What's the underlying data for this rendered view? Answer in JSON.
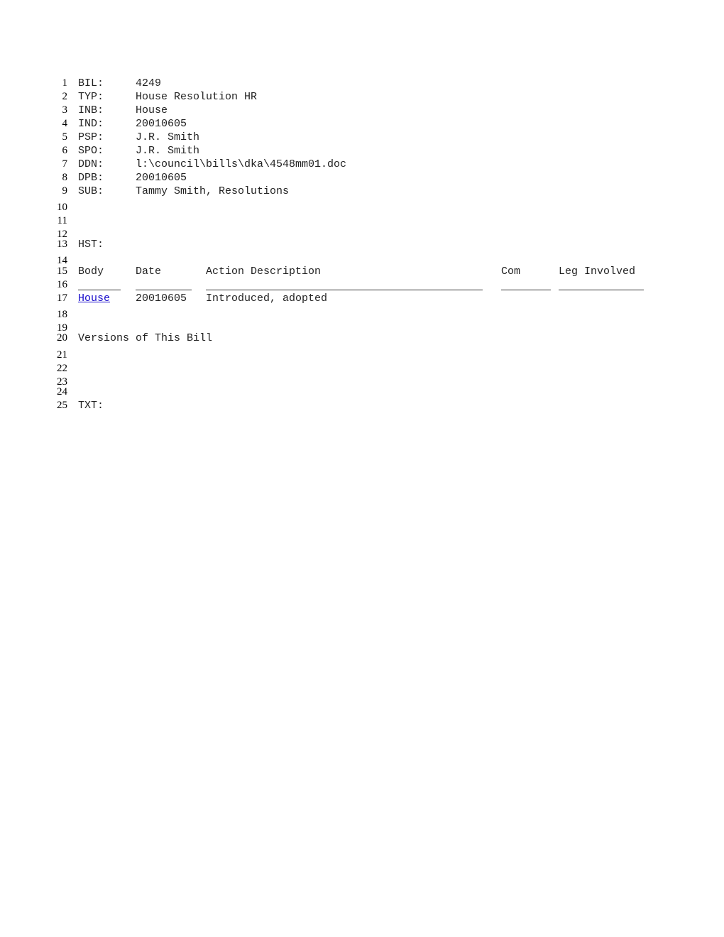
{
  "fields": [
    {
      "num": "1",
      "key": "BIL:",
      "value": "4249"
    },
    {
      "num": "2",
      "key": "TYP:",
      "value": "House Resolution HR"
    },
    {
      "num": "3",
      "key": "INB:",
      "value": "House"
    },
    {
      "num": "4",
      "key": "IND:",
      "value": "20010605"
    },
    {
      "num": "5",
      "key": "PSP:",
      "value": "J.R. Smith"
    },
    {
      "num": "6",
      "key": "SPO:",
      "value": "J.R. Smith"
    },
    {
      "num": "7",
      "key": "DDN:",
      "value": "l:\\council\\bills\\dka\\4548mm01.doc"
    },
    {
      "num": "8",
      "key": "DPB:",
      "value": "20010605"
    },
    {
      "num": "9",
      "key": "SUB:",
      "value": "Tammy Smith, Resolutions"
    }
  ],
  "line_numbers": [
    "10",
    "11",
    "12",
    "13",
    "14",
    "15",
    "16",
    "17",
    "18",
    "19",
    "20",
    "21",
    "22",
    "23",
    "24",
    "25"
  ],
  "history": {
    "label": "HST:",
    "headers": {
      "body": "Body",
      "date": "Date",
      "action": "Action Description",
      "com": "Com",
      "leg": "Leg Involved"
    },
    "rows": [
      {
        "body": "House",
        "date": "20010605",
        "action": "Introduced, adopted",
        "com": "",
        "leg": ""
      }
    ]
  },
  "versions_label": "Versions of This Bill",
  "text_label": "TXT:"
}
